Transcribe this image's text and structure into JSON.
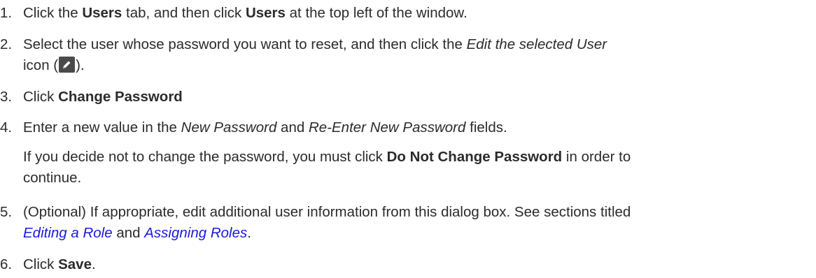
{
  "steps": [
    {
      "number": "1.",
      "t1": "Click the ",
      "b1": "Users",
      "t2": " tab, and then click ",
      "b2": "Users",
      "t3": " at the top left of the window."
    },
    {
      "number": "2.",
      "t1": "Select the user whose password you want to reset, and then click the ",
      "i1": "Edit the selected User",
      "t2": "icon (",
      "icon": "pencil-edit-icon",
      "t3": ")."
    },
    {
      "number": "3.",
      "t1": "Click ",
      "b1": "Change Password"
    },
    {
      "number": "4.",
      "t1": "Enter a new value in the ",
      "i1": "New Password",
      "t2": " and ",
      "i2": "Re-Enter New Password",
      "t3": " fields.",
      "note_t1": "If you decide not to change the password, you must click ",
      "note_b1": "Do Not Change Password",
      "note_t2": " in order to",
      "note_t3": "continue."
    },
    {
      "number": "5.",
      "t1": "(Optional) If appropriate, edit additional user information from this dialog box. See sections titled",
      "link1": "Editing a Role",
      "t2": " and ",
      "link2": "Assigning Roles",
      "t3": "."
    },
    {
      "number": "6.",
      "t1": "Click ",
      "b1": "Save",
      "t2": "."
    }
  ],
  "colors": {
    "text": "#2b2b2b",
    "link": "#1a1adf",
    "icon_bg": "#4a4a4a"
  }
}
